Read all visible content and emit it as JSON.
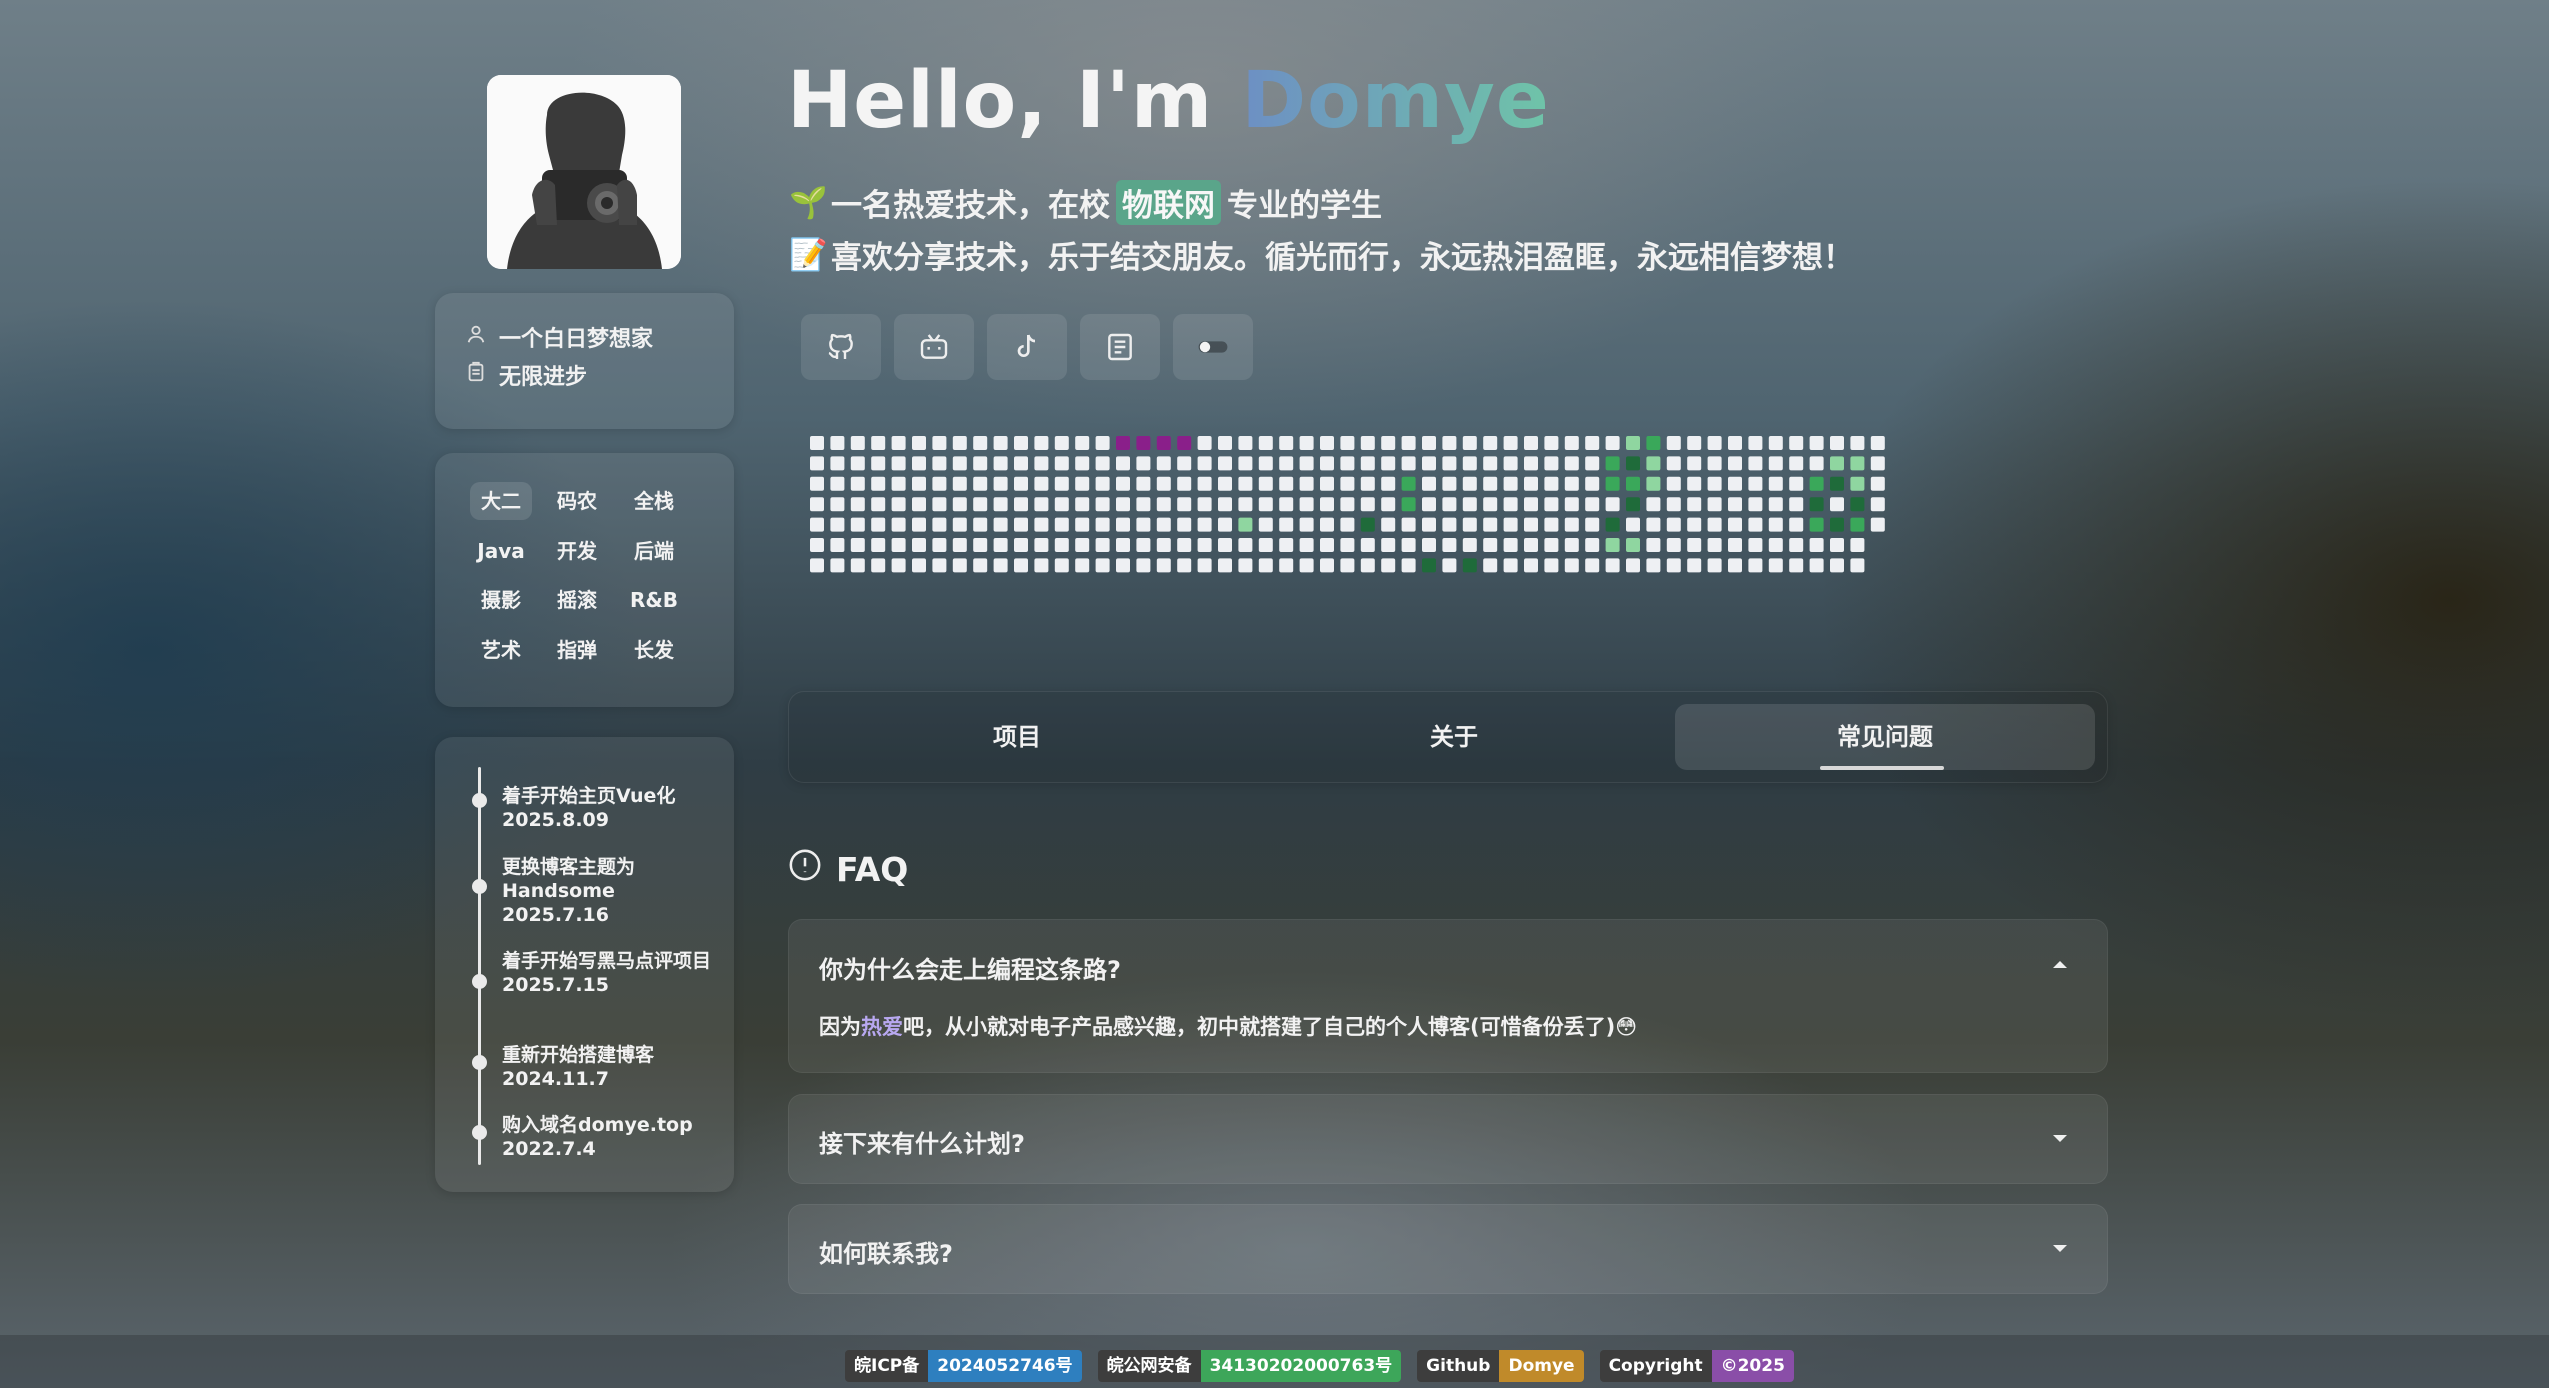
{
  "profile": {
    "name_line": "一个白日梦想家",
    "motto_line": "无限进步",
    "tags": [
      "大二",
      "码农",
      "全栈",
      "Java",
      "开发",
      "后端",
      "摄影",
      "摇滚",
      "R&B",
      "艺术",
      "指弹",
      "长发"
    ]
  },
  "timeline": [
    {
      "title": "着手开始主页Vue化",
      "date": "2025.8.09"
    },
    {
      "title": "更换博客主题为Handsome",
      "date": "2025.7.16"
    },
    {
      "title": "着手开始写黑马点评项目",
      "date": "2025.7.15"
    },
    {
      "title": "重新开始搭建博客",
      "date": "2024.11.7"
    },
    {
      "title": "购入域名domye.top",
      "date": "2022.7.4"
    }
  ],
  "header": {
    "greeting": "Hello, I'm ",
    "name": "Domye",
    "line1_emoji": "🌱",
    "line1_pre": "一名热爱技术，在校",
    "line1_highlight": "物联网",
    "line1_post": "专业的学生",
    "line2_emoji": "📝",
    "line2": "喜欢分享技术，乐于结交朋友。循光而行，永远热泪盈眶，永远相信梦想！"
  },
  "social": [
    "github-icon",
    "bilibili-icon",
    "tiktok-icon",
    "blog-icon",
    "theme-toggle"
  ],
  "tabs": [
    "项目",
    "关于",
    "常见问题"
  ],
  "faq": {
    "title": "FAQ",
    "items": [
      {
        "q": "你为什么会走上编程这条路?",
        "a_pre": "因为",
        "a_hl": "热爱",
        "a_post": "吧，从小就对电子产品感兴趣，初中就搭建了自己的个人博客(可惜备份丢了)",
        "a_emoji": "😳",
        "open": true
      },
      {
        "q": "接下来有什么计划?",
        "open": false
      },
      {
        "q": "如何联系我?",
        "open": false
      }
    ]
  },
  "footer": [
    {
      "k": "皖ICP备",
      "v": "2024052746号",
      "color": "#2e7fbf"
    },
    {
      "k": "皖公网安备",
      "v": "34130202000763号",
      "color": "#3da65a"
    },
    {
      "k": "Github",
      "v": "Domye",
      "color": "#c08a2a"
    },
    {
      "k": "Copyright",
      "v": "©2025",
      "color": "#8a4ea8"
    }
  ],
  "colors": {
    "accent": "#5aa58a",
    "contrib_purple": "#8a1f8a",
    "contrib_green_dark": "#1f6b3a",
    "contrib_green": "#3aa85a",
    "contrib_green_light": "#8fd6a0"
  }
}
